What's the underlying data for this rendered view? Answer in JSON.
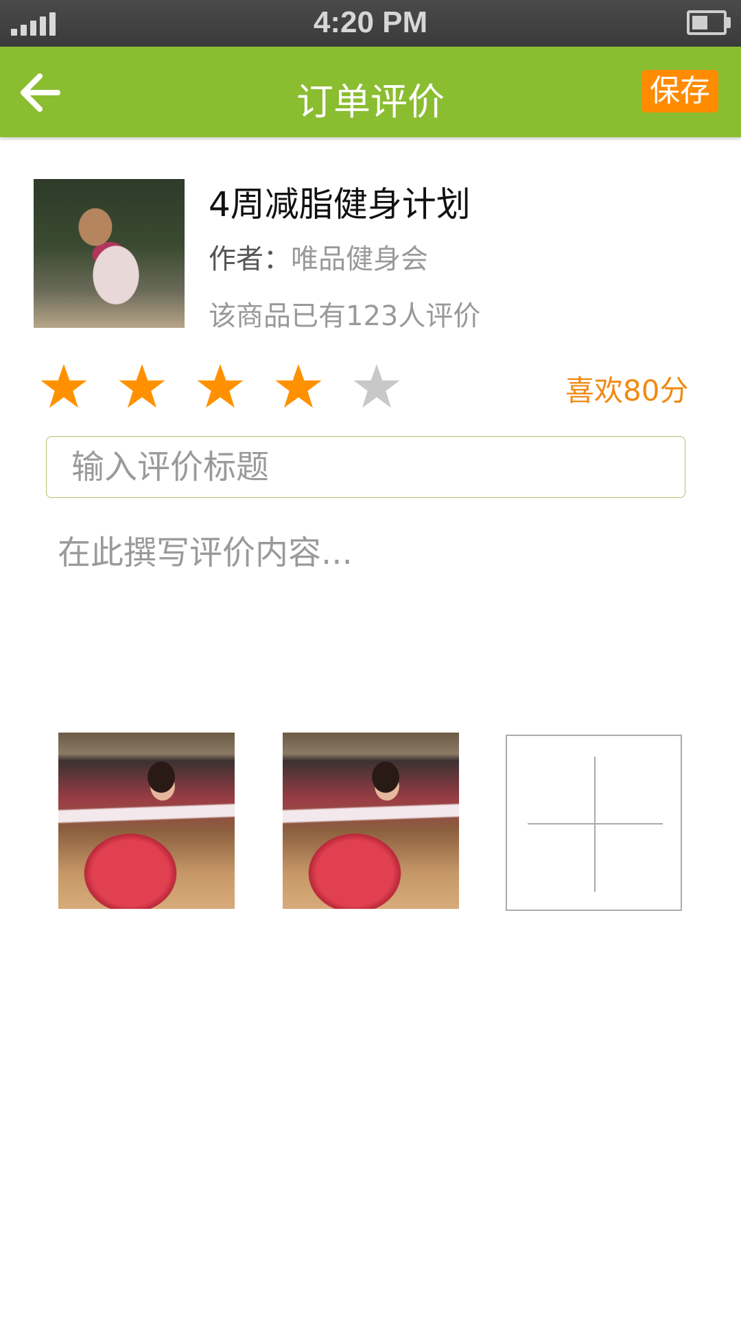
{
  "status_bar": {
    "time": "4:20 PM",
    "signal_icon": "signal-bars-icon",
    "battery_icon": "battery-icon"
  },
  "header": {
    "back_icon": "arrow-left-icon",
    "title": "订单评价",
    "save_label": "保存",
    "background_color": "#8bbd31",
    "save_color": "#ff8c00"
  },
  "product": {
    "title": "4周减脂健身计划",
    "author_label": "作者：",
    "author_name": "唯品健身会",
    "review_count_text": "该商品已有123人评价"
  },
  "rating": {
    "stars_filled": 4,
    "stars_total": 5,
    "star_color": "#ff9100",
    "star_empty_color": "#c8c8c8",
    "text": "喜欢80分",
    "text_color": "#f08a14"
  },
  "review": {
    "title_placeholder": "输入评价标题",
    "content_placeholder": "在此撰写评价内容..."
  },
  "photos": {
    "items": [
      "uploaded-photo",
      "uploaded-photo"
    ],
    "add_icon": "plus-icon"
  }
}
